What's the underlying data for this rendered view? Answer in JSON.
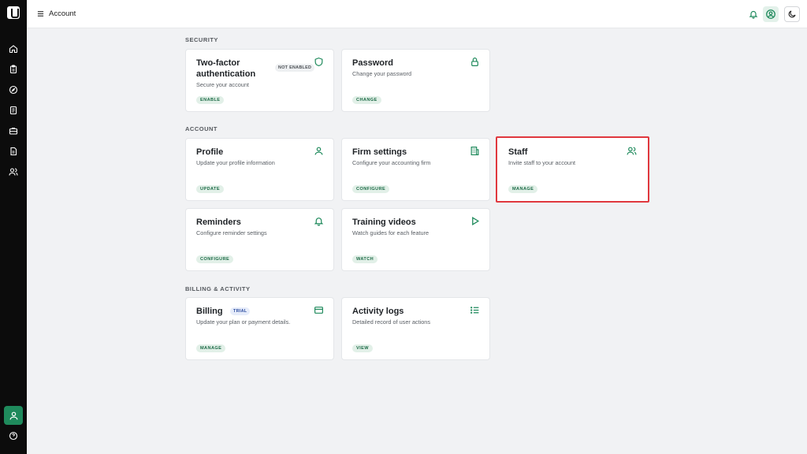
{
  "header": {
    "title": "Account"
  },
  "sidebar": {
    "items": [
      {
        "icon": "home-icon"
      },
      {
        "icon": "clipboard-icon"
      },
      {
        "icon": "compass-icon"
      },
      {
        "icon": "document-list-icon"
      },
      {
        "icon": "briefcase-icon"
      },
      {
        "icon": "file-text-icon"
      },
      {
        "icon": "users-icon"
      }
    ],
    "bottom": [
      {
        "icon": "user-icon"
      },
      {
        "icon": "help-icon"
      }
    ]
  },
  "sections": {
    "security": "SECURITY",
    "account": "ACCOUNT",
    "billing": "BILLING & ACTIVITY"
  },
  "cards": {
    "two_factor": {
      "title": "Two-factor authentication",
      "desc": "Secure your account",
      "action": "ENABLE",
      "badge": "NOT ENABLED"
    },
    "password": {
      "title": "Password",
      "desc": "Change your password",
      "action": "CHANGE"
    },
    "profile": {
      "title": "Profile",
      "desc": "Update your profile information",
      "action": "UPDATE"
    },
    "firm": {
      "title": "Firm settings",
      "desc": "Configure your accounting firm",
      "action": "CONFIGURE"
    },
    "staff": {
      "title": "Staff",
      "desc": "Invite staff to your account",
      "action": "MANAGE"
    },
    "reminders": {
      "title": "Reminders",
      "desc": "Configure reminder settings",
      "action": "CONFIGURE"
    },
    "training": {
      "title": "Training videos",
      "desc": "Watch guides for each feature",
      "action": "WATCH"
    },
    "billing": {
      "title": "Billing",
      "desc": "Update your plan or payment details.",
      "action": "MANAGE",
      "badge": "TRIAL"
    },
    "activity": {
      "title": "Activity logs",
      "desc": "Detailed record of user actions",
      "action": "VIEW"
    }
  },
  "colors": {
    "accent": "#1f8a5c",
    "highlight": "#e0383e",
    "sidebar": "#0c0c0c"
  }
}
